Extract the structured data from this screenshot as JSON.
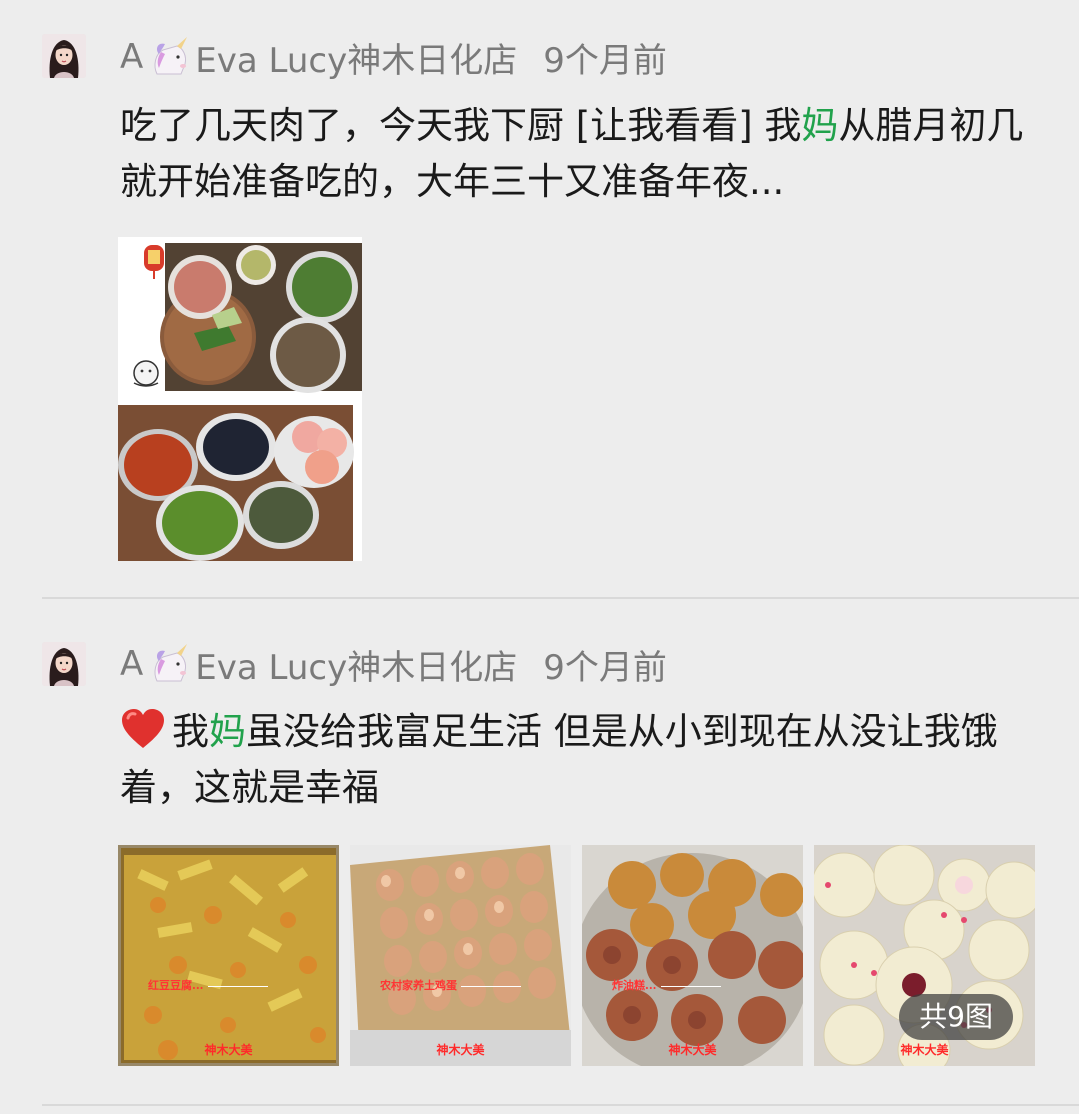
{
  "posts": [
    {
      "author_prefix": "A",
      "author_icon": "unicorn-emoji",
      "author_name": "Eva Lucy神木日化店",
      "time": "9个月前",
      "text_part1": "吃了几天肉了，今天我下厨 [让我看看] 我",
      "text_highlight": "妈",
      "text_part2": "从腊月初几就开始准备吃的，大年三十又准备年夜...",
      "images": [
        "food-prep-collage"
      ]
    },
    {
      "author_prefix": "A",
      "author_icon": "unicorn-emoji",
      "author_name": "Eva Lucy神木日化店",
      "time": "9个月前",
      "text_icon": "red-heart-emoji",
      "text_part1": "我",
      "text_highlight": "妈",
      "text_part2": "虽没给我富足生活 但是从小到现在从没让我饿着，这就是幸福",
      "images": [
        "fried-snacks",
        "eggs-tray",
        "fried-cakes",
        "steamed-buns"
      ],
      "image_captions": [
        "红豆豆腐...",
        "农村家养土鸡蛋",
        "炸油糕...",
        ""
      ],
      "image_watermark": "神木大美",
      "image_count_label": "共9图"
    }
  ],
  "colors": {
    "background": "#ededed",
    "highlight": "#21a24c",
    "meta_text": "#7a7a7a"
  }
}
